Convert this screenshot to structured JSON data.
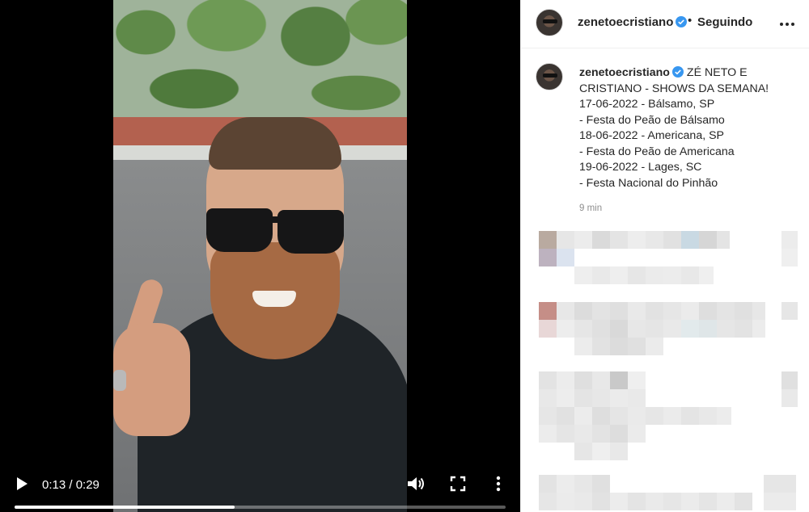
{
  "video": {
    "time_display": "0:13 / 0:29",
    "progress_fraction": 0.448
  },
  "post": {
    "username": "zenetoecristiano",
    "verified": true,
    "separator": "•",
    "follow_status": "Seguindo",
    "caption_lines": [
      "ZÉ NETO E",
      "CRISTIANO - SHOWS DA SEMANA!",
      "17-06-2022 - Bálsamo, SP",
      "- Festa do Peão de Bálsamo",
      "18-06-2022 - Americana, SP",
      "- Festa do Peão de Americana",
      "19-06-2022 - Lages, SC",
      "- Festa Nacional do Pinhão"
    ],
    "time_ago": "9 min"
  },
  "colors": {
    "verified": "#3897f0",
    "text": "#262626",
    "muted": "#8e8e8e"
  },
  "icons": [
    "play-icon",
    "volume-icon",
    "fullscreen-icon",
    "more-vertical-icon",
    "verified-badge-icon",
    "more-horizontal-icon"
  ]
}
